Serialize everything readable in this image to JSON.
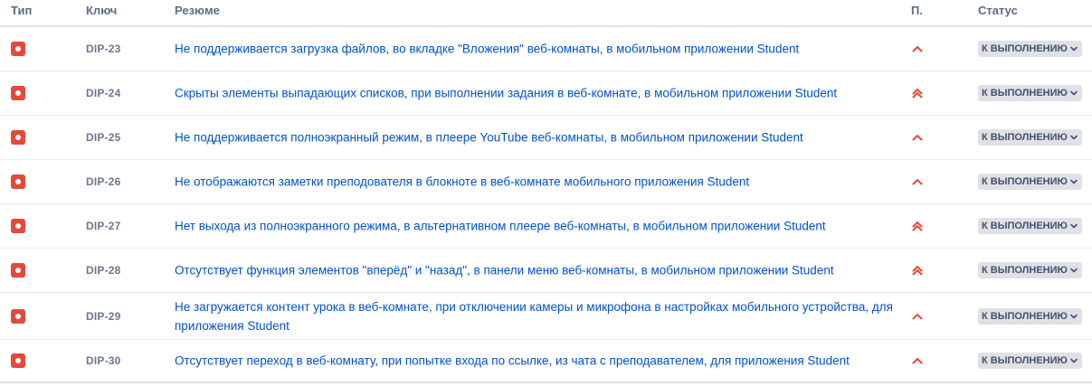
{
  "columns": {
    "type": "Тип",
    "key": "Ключ",
    "summary": "Резюме",
    "priority": "П.",
    "status": "Статус"
  },
  "colors": {
    "type_bug": "#e5493a",
    "priority": "#e5493a",
    "link": "#0052cc",
    "status_bg": "#dfe1e6"
  },
  "rows": [
    {
      "type_icon": "bug-icon",
      "key": "DIP-23",
      "summary": "Не поддерживается загрузка файлов, во вкладке \"Вложения\" веб-комнаты, в мобильном приложении Student",
      "priority": "high-priority-icon",
      "status": "К ВЫПОЛНЕНИЮ"
    },
    {
      "type_icon": "bug-icon",
      "key": "DIP-24",
      "summary": "Скрыты элементы выпадающих списков, при выполнении задания в веб-комнате, в мобильном приложении Student",
      "priority": "highest-priority-icon",
      "status": "К ВЫПОЛНЕНИЮ"
    },
    {
      "type_icon": "bug-icon",
      "key": "DIP-25",
      "summary": "Не поддерживается полноэкранный режим, в плеере YouTube веб-комнаты, в мобильном приложении Student",
      "priority": "high-priority-icon",
      "status": "К ВЫПОЛНЕНИЮ"
    },
    {
      "type_icon": "bug-icon",
      "key": "DIP-26",
      "summary": "Не отображаются заметки преподователя в блокноте в веб-комнате мобильного приложения Student",
      "priority": "high-priority-icon",
      "status": "К ВЫПОЛНЕНИЮ"
    },
    {
      "type_icon": "bug-icon",
      "key": "DIP-27",
      "summary": "Нет выхода из полноэкранного режима, в альтернативном плеере веб-комнаты, в мобильном приложении Student",
      "priority": "highest-priority-icon",
      "status": "К ВЫПОЛНЕНИЮ"
    },
    {
      "type_icon": "bug-icon",
      "key": "DIP-28",
      "summary": "Отсутствует функция элементов \"вперёд\" и \"назад\", в панели меню веб-комнаты, в мобильном приложении Student",
      "priority": "highest-priority-icon",
      "status": "К ВЫПОЛНЕНИЮ"
    },
    {
      "type_icon": "bug-icon",
      "key": "DIP-29",
      "summary": "Не загружается контент урока в веб-комнате, при отключении камеры и микрофона в настройках мобильного устройства, для приложения Student",
      "priority": "high-priority-icon",
      "status": "К ВЫПОЛНЕНИЮ"
    },
    {
      "type_icon": "bug-icon",
      "key": "DIP-30",
      "summary": "Отсутствует переход в веб-комнату, при попытке входа по ссылке, из чата с преподавателем, для приложения Student",
      "priority": "high-priority-icon",
      "status": "К ВЫПОЛНЕНИЮ"
    }
  ]
}
